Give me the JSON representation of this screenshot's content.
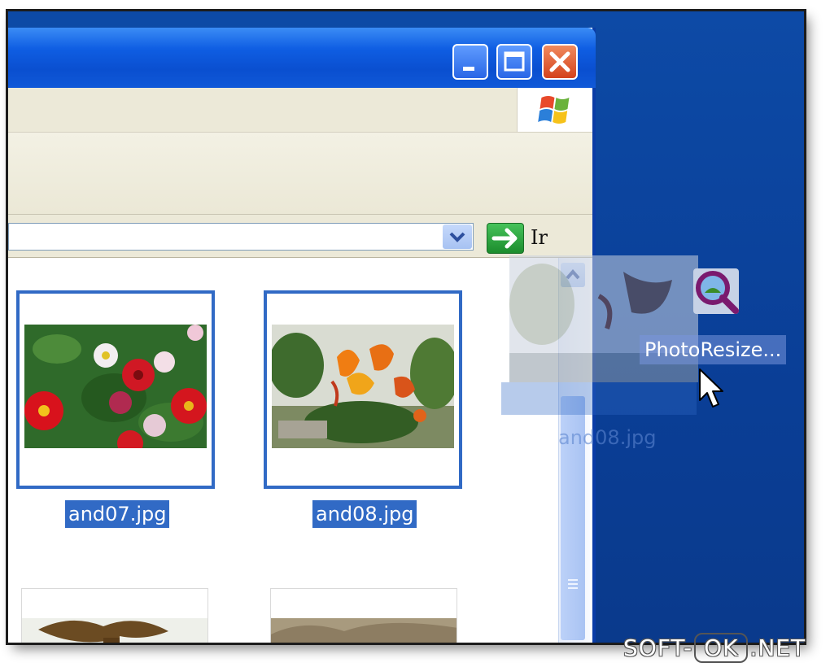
{
  "window": {
    "buttons": {
      "minimize_icon": "minimize-icon",
      "maximize_icon": "maximize-icon",
      "close_icon": "close-icon"
    },
    "logo_icon": "windows-logo-icon",
    "colors": {
      "titlebar": "#0a4fd0",
      "menubar": "#ece9d8",
      "selection": "#316ac5",
      "close": "#d4421c"
    }
  },
  "address_bar": {
    "value": "",
    "dropdown_icon": "chevron-down-icon",
    "go_icon": "go-arrow-icon",
    "go_label": "Ir"
  },
  "files": [
    {
      "name": "and07.jpg",
      "selected": true
    },
    {
      "name": "and08.jpg",
      "selected": true
    }
  ],
  "drag": {
    "ghost_label": "and08.jpg",
    "target_label": "PhotoResize...",
    "target_icon": "photoresize-icon"
  },
  "watermark": {
    "left": "SOFT-",
    "middle": "OK",
    "right": ".NET"
  },
  "desktop_color": "#0b3f93"
}
